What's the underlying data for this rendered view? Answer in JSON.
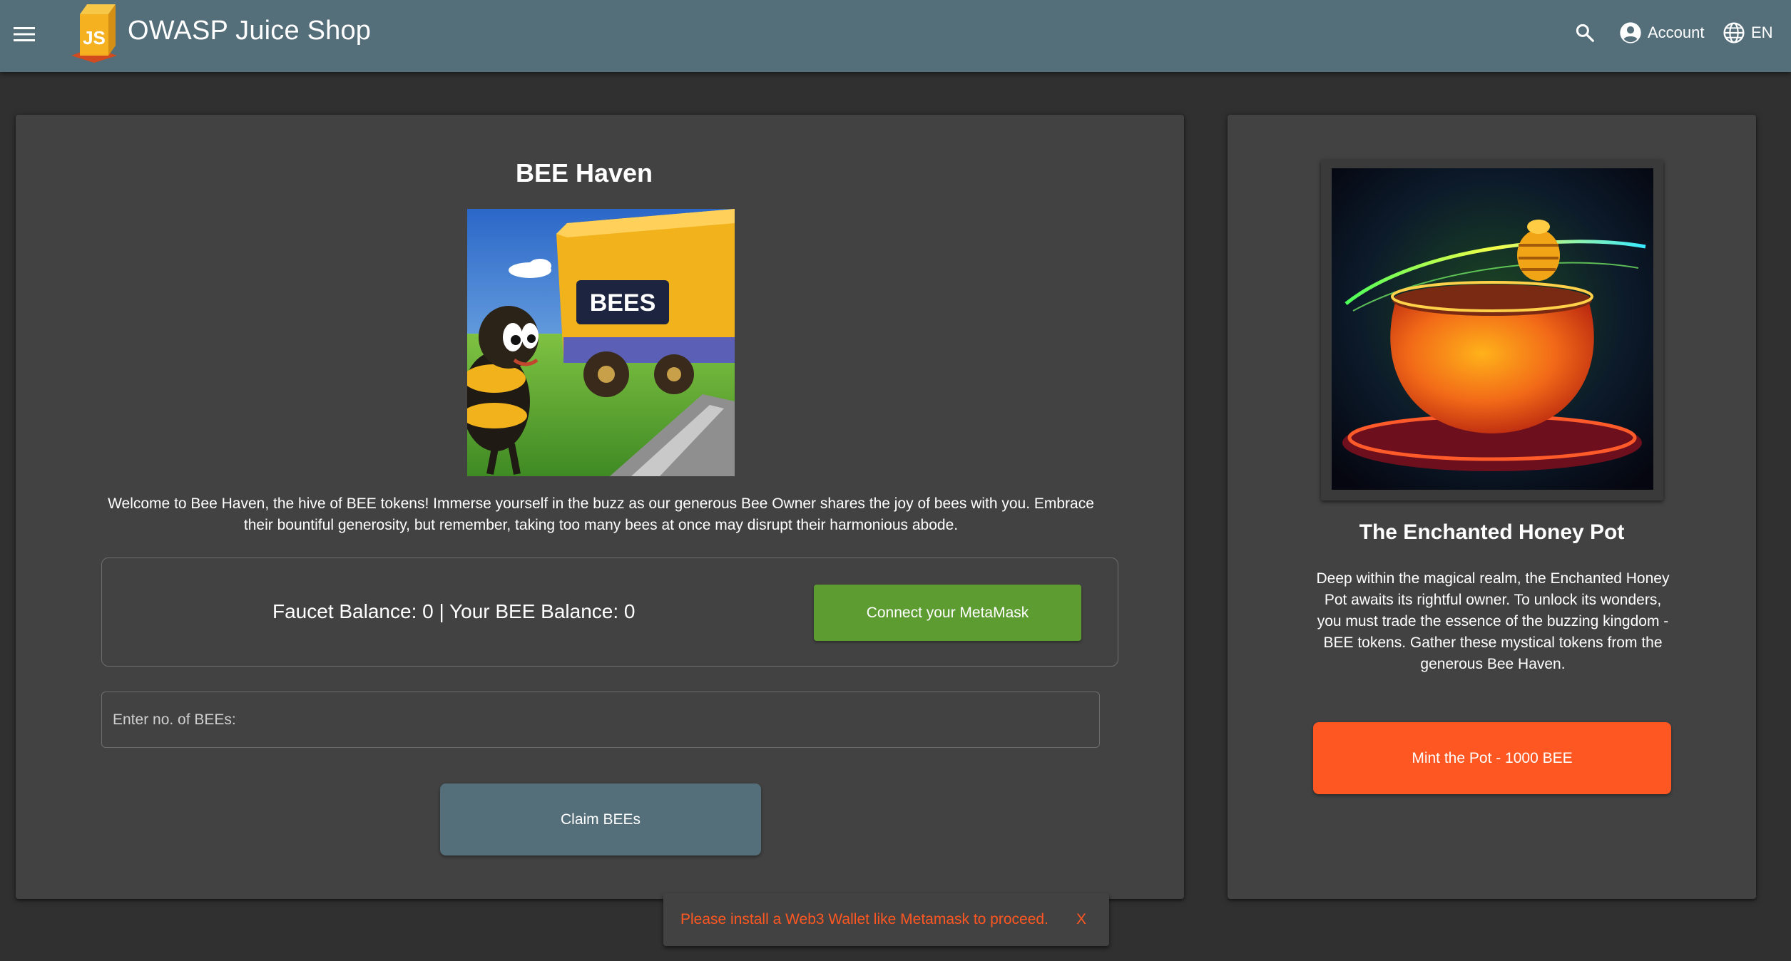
{
  "toolbar": {
    "title": "OWASP Juice Shop",
    "account_label": "Account",
    "language_label": "EN",
    "color": "#546e7a",
    "icons": {
      "menu": "menu-icon",
      "logo": "juice-shop-logo",
      "search": "search-icon",
      "account": "account-circle-icon",
      "language": "globe-icon"
    }
  },
  "faucet": {
    "title": "BEE Haven",
    "image_text": "BEES",
    "description": "Welcome to Bee Haven, the hive of BEE tokens! Immerse yourself in the buzz as our generous Bee Owner shares the joy of bees with you. Embrace their bountiful generosity, but remember, taking too many bees at once may disrupt their harmonious abode.",
    "balance_text": "Faucet Balance: 0 | Your BEE Balance: 0",
    "connect_button": "Connect your MetaMask",
    "input_placeholder": "Enter no. of BEEs:",
    "claim_button": "Claim BEEs",
    "connect_color": "#5c9c31",
    "claim_color": "#546e7a"
  },
  "honeypot": {
    "title": "The Enchanted Honey Pot",
    "description": "Deep within the magical realm, the Enchanted Honey Pot awaits its rightful owner. To unlock its wonders, you must trade the essence of the buzzing kingdom - BEE tokens. Gather these mystical tokens from the generous Bee Haven.",
    "mint_button": "Mint the Pot - 1000 BEE",
    "mint_color": "#ff5722"
  },
  "snackbar": {
    "message": "Please install a Web3 Wallet like Metamask to proceed.",
    "close_label": "X",
    "color": "#ff5722"
  }
}
